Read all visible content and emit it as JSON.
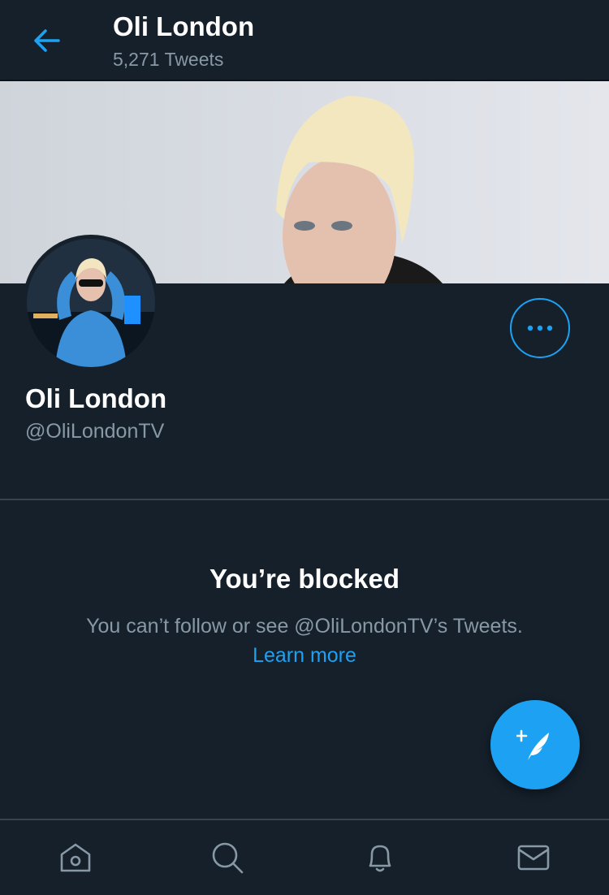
{
  "header": {
    "name": "Oli London",
    "tweet_count": "5,271 Tweets",
    "back_icon": "arrow-left-icon"
  },
  "profile": {
    "display_name": "Oli London",
    "handle": "@OliLondonTV",
    "more_icon": "more-dots-icon"
  },
  "blocked": {
    "title": "You’re blocked",
    "message": "You can’t follow or see @OliLondonTV’s Tweets.",
    "learn_more": "Learn more"
  },
  "fab": {
    "icon": "compose-tweet-icon"
  },
  "tabbar": {
    "items": [
      {
        "name": "home",
        "icon": "home-icon"
      },
      {
        "name": "search",
        "icon": "search-icon"
      },
      {
        "name": "notifications",
        "icon": "bell-icon"
      },
      {
        "name": "messages",
        "icon": "mail-icon"
      }
    ]
  },
  "colors": {
    "background": "#15202b",
    "accent": "#1da1f2",
    "secondary_text": "#8899a6",
    "divider": "#38444d"
  }
}
